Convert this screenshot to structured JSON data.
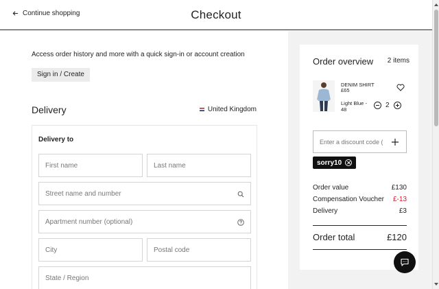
{
  "header": {
    "back_label": "Continue shopping",
    "title": "Checkout"
  },
  "signin": {
    "text": "Access order history and more with a quick sign-in or account creation",
    "button_label": "Sign in / Create"
  },
  "delivery": {
    "title": "Delivery",
    "country": "United Kingdom",
    "card_title": "Delivery to",
    "fields": {
      "first_name": "First name",
      "last_name": "Last name",
      "street": "Street name and number",
      "apartment": "Apartment number (optional)",
      "city": "City",
      "postal_code": "Postal code",
      "state": "State / Region"
    }
  },
  "overview": {
    "title": "Order overview",
    "item_count": "2 items",
    "product": {
      "name": "DENIM SHIRT",
      "price": "£65",
      "variant": "Light Blue - 48",
      "quantity": "2"
    },
    "discount_placeholder": "Enter a discount code (optional)",
    "applied_code": "sorry10",
    "lines": [
      {
        "label": "Order value",
        "value": "£130"
      },
      {
        "label": "Compensation Voucher",
        "value": "£-13"
      },
      {
        "label": "Delivery",
        "value": "£3"
      }
    ],
    "total_label": "Order total",
    "total_value": "£120"
  },
  "colors": {
    "accent": "#111111",
    "negative": "#d11a2a",
    "panel_bg": "#f2f2f2"
  }
}
